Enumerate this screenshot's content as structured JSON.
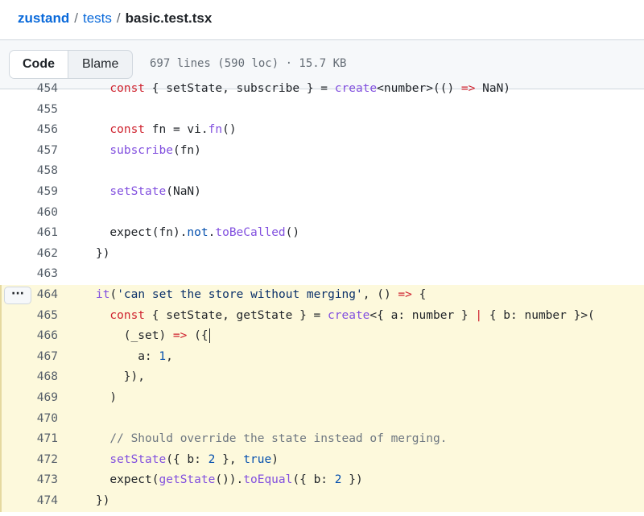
{
  "breadcrumb": {
    "repo": "zustand",
    "folder": "tests",
    "file": "basic.test.tsx",
    "separator": "/"
  },
  "toolbar": {
    "code_label": "Code",
    "blame_label": "Blame",
    "file_info": "697 lines (590 loc) · 15.7 KB"
  },
  "line_actions": {
    "more_label": "···"
  },
  "code_lines": [
    {
      "n": "454",
      "tokens": [
        [
          "k",
          "const"
        ],
        [
          "t",
          " { setState, subscribe } = "
        ],
        [
          "f",
          "create"
        ],
        [
          "t",
          "<number>(() "
        ],
        [
          "k",
          "=>"
        ],
        [
          "t",
          " NaN)"
        ]
      ]
    },
    {
      "n": "455",
      "tokens": []
    },
    {
      "n": "456",
      "tokens": [
        [
          "k",
          "const"
        ],
        [
          "t",
          " fn = vi."
        ],
        [
          "f",
          "fn"
        ],
        [
          "t",
          "()"
        ]
      ]
    },
    {
      "n": "457",
      "tokens": [
        [
          "f",
          "subscribe"
        ],
        [
          "t",
          "(fn)"
        ]
      ]
    },
    {
      "n": "458",
      "tokens": []
    },
    {
      "n": "459",
      "tokens": [
        [
          "f",
          "setState"
        ],
        [
          "t",
          "(NaN)"
        ]
      ]
    },
    {
      "n": "460",
      "tokens": []
    },
    {
      "n": "461",
      "tokens": [
        [
          "t",
          "expect(fn)."
        ],
        [
          "n",
          "not"
        ],
        [
          "t",
          "."
        ],
        [
          "f",
          "toBeCalled"
        ],
        [
          "t",
          "()"
        ]
      ]
    },
    {
      "n": "462",
      "tokens": [
        [
          "t",
          "})"
        ]
      ]
    },
    {
      "n": "463",
      "tokens": []
    },
    {
      "n": "464",
      "tokens": [
        [
          "f",
          "it"
        ],
        [
          "t",
          "("
        ],
        [
          "s",
          "'can set the store without merging'"
        ],
        [
          "t",
          ", () "
        ],
        [
          "k",
          "=>"
        ],
        [
          "t",
          " {"
        ]
      ]
    },
    {
      "n": "465",
      "tokens": [
        [
          "k",
          "const"
        ],
        [
          "t",
          " { setState, getState } = "
        ],
        [
          "f",
          "create"
        ],
        [
          "t",
          "<{ a: number } "
        ],
        [
          "k",
          "|"
        ],
        [
          "t",
          " { b: number }>("
        ]
      ]
    },
    {
      "n": "466",
      "tokens": [
        [
          "t",
          "(_set) "
        ],
        [
          "k",
          "=>"
        ],
        [
          "t",
          " ({"
        ]
      ]
    },
    {
      "n": "467",
      "tokens": [
        [
          "t",
          "a: "
        ],
        [
          "n",
          "1"
        ],
        [
          "t",
          ","
        ]
      ]
    },
    {
      "n": "468",
      "tokens": [
        [
          "t",
          "}),"
        ]
      ]
    },
    {
      "n": "469",
      "tokens": [
        [
          "t",
          ")"
        ]
      ]
    },
    {
      "n": "470",
      "tokens": []
    },
    {
      "n": "471",
      "tokens": [
        [
          "c",
          "// Should override the state instead of merging."
        ]
      ]
    },
    {
      "n": "472",
      "tokens": [
        [
          "f",
          "setState"
        ],
        [
          "t",
          "({ b: "
        ],
        [
          "n",
          "2"
        ],
        [
          "t",
          " }, "
        ],
        [
          "n",
          "true"
        ],
        [
          "t",
          ")"
        ]
      ]
    },
    {
      "n": "473",
      "tokens": [
        [
          "t",
          "expect("
        ],
        [
          "f",
          "getState"
        ],
        [
          "t",
          "())."
        ],
        [
          "f",
          "toEqual"
        ],
        [
          "t",
          "({ b: "
        ],
        [
          "n",
          "2"
        ],
        [
          "t",
          " })"
        ]
      ]
    },
    {
      "n": "474",
      "tokens": [
        [
          "t",
          "})"
        ]
      ]
    }
  ]
}
